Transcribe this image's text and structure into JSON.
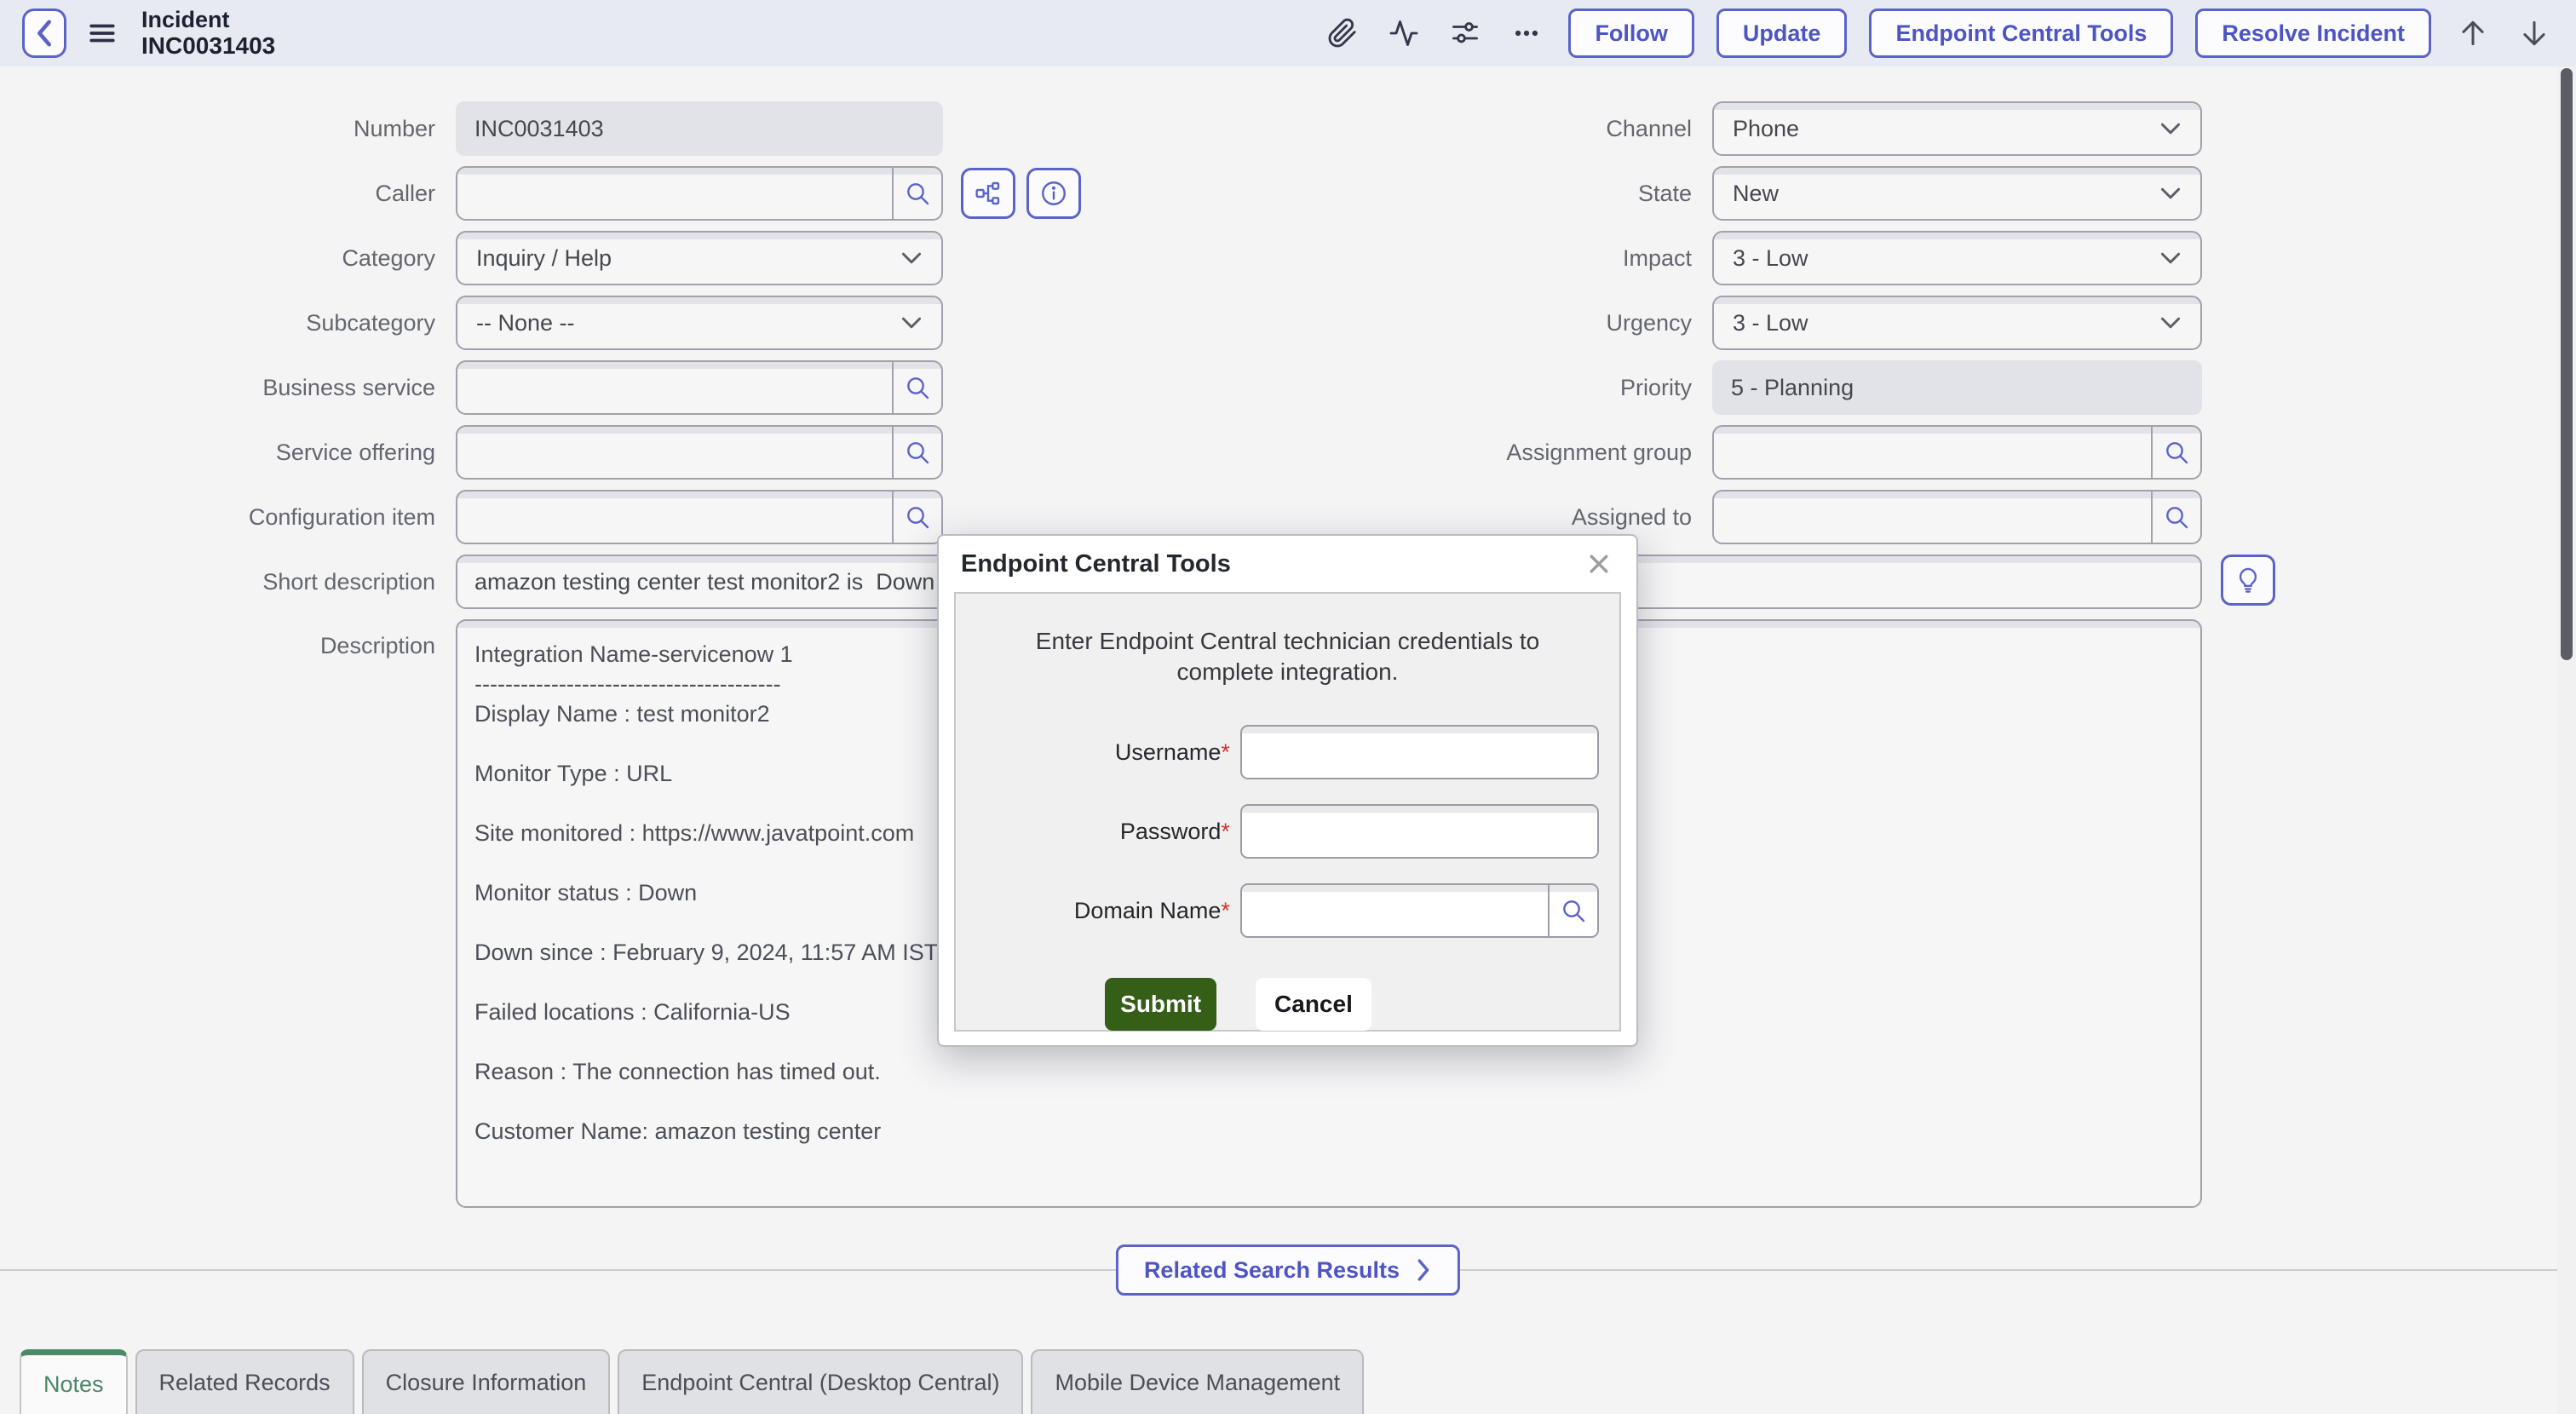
{
  "colors": {
    "accent_indigo": "#5b63c8",
    "submit_green": "#355e17",
    "tab_green": "#4d8a66",
    "header_bg": "#e8eaf1",
    "required_red": "#d1342b"
  },
  "header": {
    "title_line1": "Incident",
    "title_line2": "INC0031403",
    "icons": [
      "back-icon",
      "menu-icon",
      "attachment-icon",
      "activity-icon",
      "sliders-icon",
      "more-icon",
      "arrow-up-icon",
      "arrow-down-icon"
    ],
    "actions": {
      "follow": "Follow",
      "update": "Update",
      "endpoint_tools": "Endpoint Central Tools",
      "resolve": "Resolve Incident"
    }
  },
  "form": {
    "left": [
      {
        "label": "Number",
        "value": "INC0031403",
        "type": "readonly"
      },
      {
        "label": "Caller",
        "value": "",
        "type": "search"
      },
      {
        "label": "Category",
        "value": "Inquiry / Help",
        "type": "select"
      },
      {
        "label": "Subcategory",
        "value": "-- None --",
        "type": "select"
      },
      {
        "label": "Business service",
        "value": "",
        "type": "search"
      },
      {
        "label": "Service offering",
        "value": "",
        "type": "search"
      },
      {
        "label": "Configuration item",
        "value": "",
        "type": "search"
      },
      {
        "label": "Short description",
        "value": "amazon testing center test monitor2 is  Down",
        "type": "text"
      },
      {
        "label": "Description",
        "value": "Integration Name-servicenow 1\n----------------------------------------\nDisplay Name : test monitor2\n\nMonitor Type : URL\n\nSite monitored : https://www.javatpoint.com\n\nMonitor status  : Down\n\nDown since : February 9, 2024, 11:57 AM IST\n\nFailed locations : California-US\n\nReason : The connection has timed out.\n\nCustomer Name: amazon testing center",
        "type": "textarea"
      }
    ],
    "right": [
      {
        "label": "Channel",
        "value": "Phone",
        "type": "select"
      },
      {
        "label": "State",
        "value": "New",
        "type": "select"
      },
      {
        "label": "Impact",
        "value": "3 - Low",
        "type": "select"
      },
      {
        "label": "Urgency",
        "value": "3 - Low",
        "type": "select"
      },
      {
        "label": "Priority",
        "value": "5 - Planning",
        "type": "readonly"
      },
      {
        "label": "Assignment group",
        "value": "",
        "type": "search"
      },
      {
        "label": "Assigned to",
        "value": "",
        "type": "search"
      }
    ]
  },
  "modal": {
    "title": "Endpoint Central Tools",
    "close_icon": "close-icon",
    "instruction": "Enter Endpoint Central technician credentials to complete integration.",
    "star": "*",
    "fields": [
      {
        "label": "Username"
      },
      {
        "label": "Password"
      },
      {
        "label": "Domain Name"
      }
    ],
    "submit": "Submit",
    "cancel": "Cancel"
  },
  "related_button": "Related Search Results",
  "tabs": [
    {
      "label": "Notes",
      "active": true
    },
    {
      "label": "Related Records",
      "active": false
    },
    {
      "label": "Closure Information",
      "active": false
    },
    {
      "label": "Endpoint Central (Desktop Central)",
      "active": false
    },
    {
      "label": "Mobile Device Management",
      "active": false
    }
  ]
}
